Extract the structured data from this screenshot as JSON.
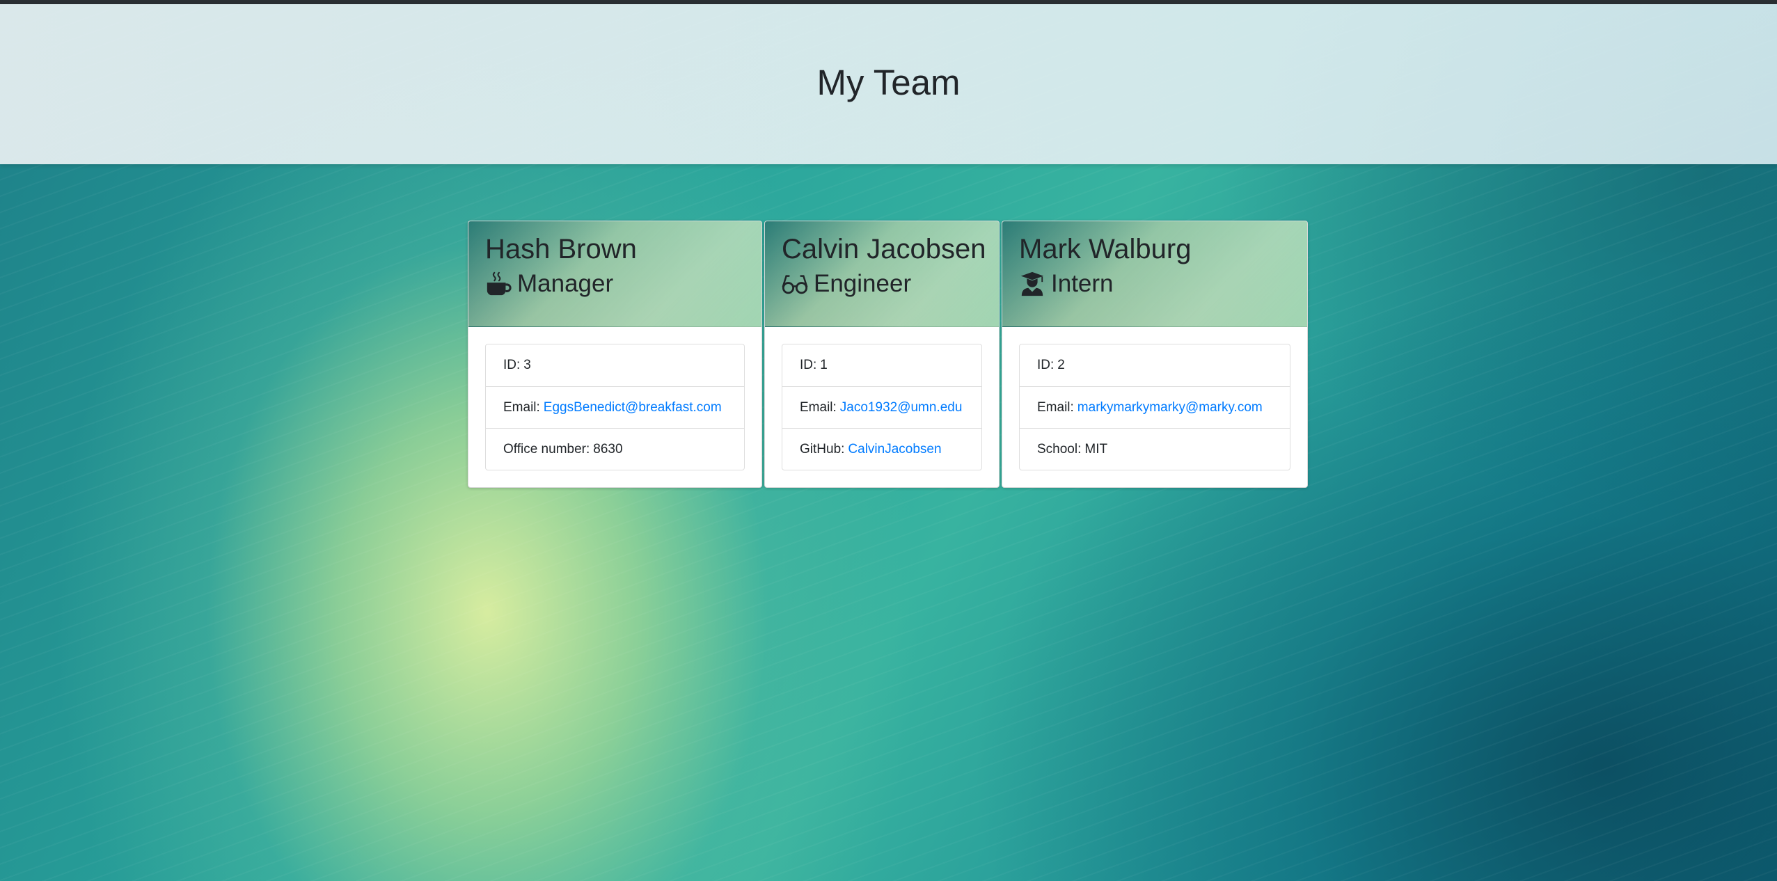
{
  "page": {
    "title": "My Team"
  },
  "employees": [
    {
      "name": "Hash Brown",
      "role": "Manager",
      "icon": "coffee-icon",
      "id_label": "ID:",
      "id": "3",
      "email_label": "Email:",
      "email": "EggsBenedict@breakfast.com",
      "extra_label": "Office number:",
      "extra_value": "8630"
    },
    {
      "name": "Calvin Jacobsen",
      "role": "Engineer",
      "icon": "glasses-icon",
      "id_label": "ID:",
      "id": "1",
      "email_label": "Email:",
      "email": "Jaco1932@umn.edu",
      "extra_label": "GitHub:",
      "extra_value": "CalvinJacobsen"
    },
    {
      "name": "Mark Walburg",
      "role": "Intern",
      "icon": "graduate-icon",
      "id_label": "ID:",
      "id": "2",
      "email_label": "Email:",
      "email": "markymarkymarky@marky.com",
      "extra_label": "School:",
      "extra_value": "MIT"
    }
  ],
  "colors": {
    "link": "#007bff",
    "text": "#212529"
  }
}
